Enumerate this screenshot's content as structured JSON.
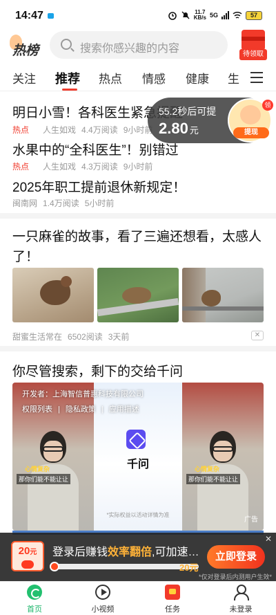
{
  "status_bar": {
    "time": "14:47",
    "net_speed_value": "11.7",
    "net_speed_unit": "KB/s",
    "signal": "5G",
    "battery": "57"
  },
  "header": {
    "logo": "热榜",
    "search_placeholder": "搜索你感兴趣的内容",
    "redpacket_label": "待领取"
  },
  "tabs": [
    "关注",
    "推荐",
    "热点",
    "情感",
    "健康",
    "生"
  ],
  "active_tab": "推荐",
  "hot_news": [
    {
      "title": "明日小雪！各科医生紧急提醒",
      "tag": "热点",
      "source": "人生如戏",
      "reads": "4.4万阅读",
      "time": "9小时前"
    },
    {
      "title": "水果中的“全科医生”！别错过",
      "tag": "热点",
      "source": "人生如戏",
      "reads": "4.3万阅读",
      "time": "9小时前"
    },
    {
      "title": "2025年职工提前退休新规定！",
      "tag": "",
      "source": "闽南网",
      "reads": "1.4万阅读",
      "time": "5小时前"
    }
  ],
  "timer": {
    "text": "55.2秒后可提",
    "amount": "2.80",
    "unit": "元",
    "withdraw": "提现",
    "tag": "领"
  },
  "article": {
    "title": "一只麻雀的故事，看了三遍还想看，太感人了！",
    "source": "甜蜜生活常在",
    "reads": "6502阅读",
    "time": "3天前"
  },
  "ad": {
    "title": "你尽管搜索，剩下的交给千问",
    "developer": "开发者：上海智信普惠科技有限公司",
    "links": [
      "权限列表",
      "隐私政策",
      "应用描述"
    ],
    "app_name": "千问",
    "note": "*实际权益以活动详情为准",
    "caption_yellow": "心情复杂",
    "caption_white": "那你们能不能让让",
    "badge": "广告"
  },
  "login_banner": {
    "coupon_amount": "20",
    "coupon_unit": "元",
    "text_before": "登录后赚钱",
    "text_highlight": "效率翻倍",
    "text_after": ",可加速…",
    "progress_amount": "20元",
    "progress_fraction": 0.02,
    "button": "立即登录",
    "note": "*仅对登录后内测用户生效*",
    "close": "✕"
  },
  "bottom_nav": [
    {
      "label": "首页",
      "icon": "home-icon",
      "active": true
    },
    {
      "label": "小视频",
      "icon": "video-icon",
      "active": false
    },
    {
      "label": "任务",
      "icon": "task-icon",
      "active": false
    },
    {
      "label": "未登录",
      "icon": "user-icon",
      "active": false
    }
  ],
  "colors": {
    "accent_red": "#f03c2e",
    "active_green": "#1bb56a",
    "highlight_orange": "#ffb238"
  }
}
